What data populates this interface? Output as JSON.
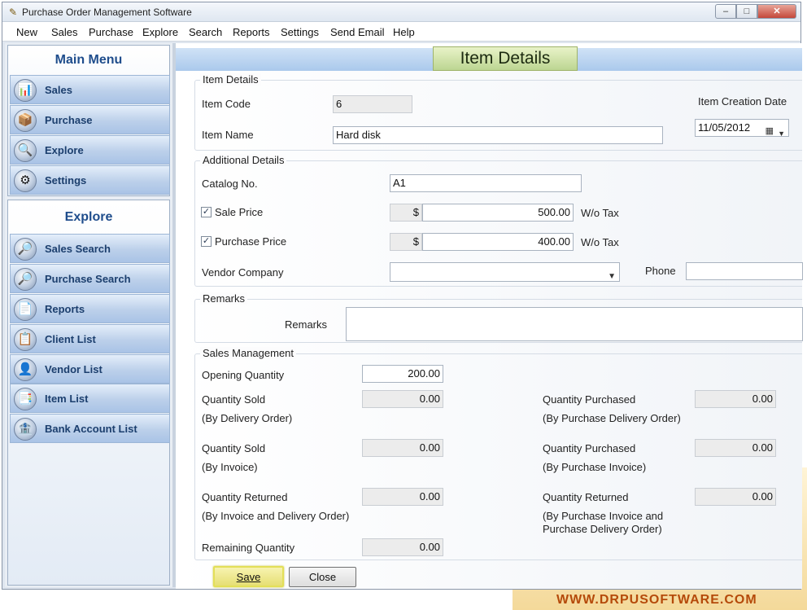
{
  "window": {
    "title": "Purchase Order Management Software",
    "controls": {
      "minimize": "–",
      "maximize": "□",
      "close": "✕"
    }
  },
  "menubar": [
    "New",
    "Sales",
    "Purchase",
    "Explore",
    "Search",
    "Reports",
    "Settings",
    "Send Email",
    "Help"
  ],
  "sidebar": {
    "main_menu_title": "Main Menu",
    "main_menu": [
      {
        "label": "Sales",
        "icon": "sales-chart-icon",
        "glyph": "📊"
      },
      {
        "label": "Purchase",
        "icon": "purchase-box-icon",
        "glyph": "📦"
      },
      {
        "label": "Explore",
        "icon": "explore-icon",
        "glyph": "🔍"
      },
      {
        "label": "Settings",
        "icon": "settings-gear-icon",
        "glyph": "⚙"
      }
    ],
    "explore_title": "Explore",
    "explore": [
      {
        "label": "Sales Search",
        "icon": "sales-search-icon",
        "glyph": "🔎"
      },
      {
        "label": "Purchase Search",
        "icon": "purchase-search-icon",
        "glyph": "🔎"
      },
      {
        "label": "Reports",
        "icon": "reports-icon",
        "glyph": "📄"
      },
      {
        "label": "Client List",
        "icon": "client-list-icon",
        "glyph": "📋"
      },
      {
        "label": "Vendor List",
        "icon": "vendor-list-icon",
        "glyph": "👤"
      },
      {
        "label": "Item List",
        "icon": "item-list-icon",
        "glyph": "📑"
      },
      {
        "label": "Bank Account List",
        "icon": "bank-icon",
        "glyph": "🏦"
      }
    ]
  },
  "page_title": "Item Details",
  "item_details": {
    "group_title": "Item Details",
    "item_code_label": "Item Code",
    "item_code": "6",
    "item_name_label": "Item Name",
    "item_name": "Hard disk",
    "creation_date_label": "Item Creation Date",
    "creation_date": "11/05/2012"
  },
  "additional_details": {
    "group_title": "Additional Details",
    "catalog_label": "Catalog No.",
    "catalog": "A1",
    "sale_price_label": "Sale Price",
    "sale_price_checked": true,
    "sale_price_currency": "$",
    "sale_price": "500.00",
    "sale_tax_label": "W/o Tax",
    "purchase_price_label": "Purchase Price",
    "purchase_price_checked": true,
    "purchase_price_currency": "$",
    "purchase_price": "400.00",
    "purchase_tax_label": "W/o Tax",
    "vendor_label": "Vendor Company",
    "vendor": "",
    "phone_label": "Phone",
    "phone": ""
  },
  "remarks": {
    "group_title": "Remarks",
    "label": "Remarks",
    "value": ""
  },
  "sales_management": {
    "group_title": "Sales Management",
    "opening_qty_label": "Opening Quantity",
    "opening_qty": "200.00",
    "sold_delivery_label": "Quantity Sold",
    "sold_delivery_sub": "(By Delivery Order)",
    "sold_delivery": "0.00",
    "sold_invoice_label": "Quantity Sold",
    "sold_invoice_sub": "(By Invoice)",
    "sold_invoice": "0.00",
    "returned_label": "Quantity Returned",
    "returned_sub": "(By Invoice and Delivery Order)",
    "returned": "0.00",
    "remaining_label": "Remaining Quantity",
    "remaining": "0.00",
    "purchased_delivery_label": "Quantity Purchased",
    "purchased_delivery_sub": "(By Purchase Delivery Order)",
    "purchased_delivery": "0.00",
    "purchased_invoice_label": "Quantity Purchased",
    "purchased_invoice_sub": "(By Purchase Invoice)",
    "purchased_invoice": "0.00",
    "purchase_returned_label": "Quantity Returned",
    "purchase_returned_sub1": "(By Purchase Invoice and",
    "purchase_returned_sub2": "Purchase Delivery Order)",
    "purchase_returned": "0.00"
  },
  "buttons": {
    "save": "Save",
    "close": "Close"
  },
  "brand": "WWW.DRPUSOFTWARE.COM"
}
